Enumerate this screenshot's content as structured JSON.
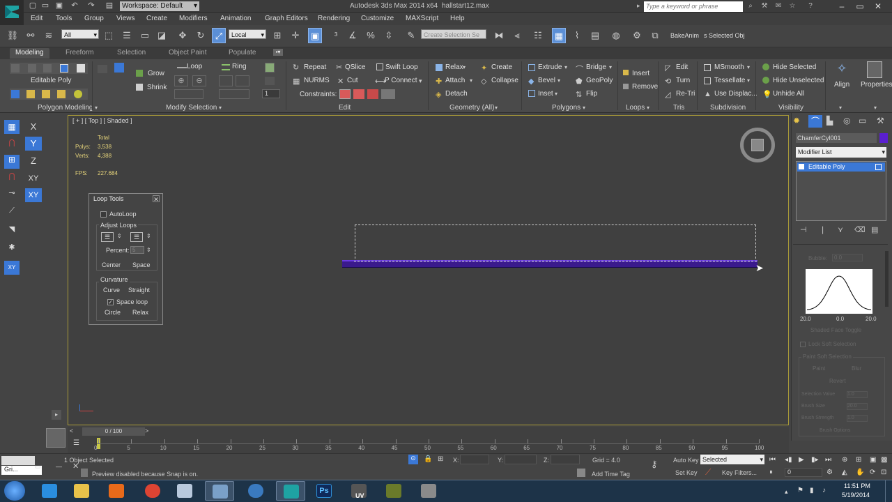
{
  "titlebar": {
    "workspace": "Workspace: Default",
    "app_title": "Autodesk 3ds Max  2014 x64",
    "file_title": "hallstart12.max",
    "search_placeholder": "Type a keyword or phrase"
  },
  "menu": [
    "Edit",
    "Tools",
    "Group",
    "Views",
    "Create",
    "Modifiers",
    "Animation",
    "Graph Editors",
    "Rendering",
    "Customize",
    "MAXScript",
    "Help"
  ],
  "toolbar": {
    "selection_filter": "All",
    "ref_coord": "Local",
    "named_selection": "Create Selection Se",
    "bake_anim": "BakeAnim",
    "selected_obj": "s Selected Obj"
  },
  "ribbon_tabs": [
    "Modeling",
    "Freeform",
    "Selection",
    "Object Paint",
    "Populate"
  ],
  "ribbon": {
    "poly_modeling": {
      "editable_poly": "Editable Poly",
      "title": "Polygon Modeling"
    },
    "modify_selection": {
      "grow": "Grow",
      "shrink": "Shrink",
      "loop": "Loop",
      "ring": "Ring",
      "title": "Modify Selection",
      "spinner": "1"
    },
    "edit": {
      "repeat": "Repeat",
      "qslice": "QSlice",
      "swift_loop": "Swift Loop",
      "nurms": "NURMS",
      "cut": "Cut",
      "p_connect": "P Connect",
      "constraints": "Constraints:",
      "title": "Edit"
    },
    "geometry": {
      "relax": "Relax",
      "create": "Create",
      "attach": "Attach",
      "collapse": "Collapse",
      "detach": "Detach",
      "title": "Geometry (All)"
    },
    "polygons": {
      "extrude": "Extrude",
      "bridge": "Bridge",
      "bevel": "Bevel",
      "geopoly": "GeoPoly",
      "inset": "Inset",
      "flip": "Flip",
      "title": "Polygons"
    },
    "loops": {
      "insert": "Insert",
      "remove": "Remove",
      "title": "Loops"
    },
    "tris": {
      "edit": "Edit",
      "turn": "Turn",
      "retri": "Re-Tri",
      "title": "Tris"
    },
    "subdivision": {
      "msmooth": "MSmooth",
      "tessellate": "Tessellate",
      "use_displac": "Use Displac...",
      "title": "Subdivision"
    },
    "visibility": {
      "hide_selected": "Hide Selected",
      "hide_unselected": "Hide Unselected",
      "unhide_all": "Unhide All",
      "title": "Visibility"
    },
    "align": "Align",
    "properties": "Properties"
  },
  "axis_buttons": [
    "X",
    "Y",
    "Z",
    "XY",
    "XY"
  ],
  "viewport": {
    "label": "[ + ] [ Top ] [ Shaded ]",
    "stats": {
      "total": "Total",
      "polys_label": "Polys:",
      "polys": "3,538",
      "verts_label": "Verts:",
      "verts": "4,388",
      "fps_label": "FPS:",
      "fps": "227.684"
    }
  },
  "loop_tools": {
    "title": "Loop Tools",
    "autoloop": "AutoLoop",
    "adjust_loops": "Adjust Loops",
    "percent_label": "Percent:",
    "percent_value": "5",
    "center": "Center",
    "space": "Space",
    "curvature": "Curvature",
    "curve": "Curve",
    "straight": "Straight",
    "space_loop": "Space loop",
    "circle": "Circle",
    "relax": "Relax"
  },
  "command_panel": {
    "object_name": "ChamferCyl001",
    "modifier_list": "Modifier List",
    "stack_item": "Editable Poly",
    "bubble_label": "Bubble:",
    "bubble_value": "0.0",
    "curve_labels": [
      "20.0",
      "0.0",
      "20.0"
    ],
    "shaded_face_toggle": "Shaded Face Toggle",
    "lock_soft_selection": "Lock Soft Selection",
    "paint_soft_selection": "Paint Soft Selection",
    "paint": "Paint",
    "blur": "Blur",
    "revert": "Revert",
    "selection_value_label": "Selection Value",
    "selection_value": "1.0",
    "brush_size_label": "Brush Size",
    "brush_size": "20.0",
    "brush_strength_label": "Brush Strength",
    "brush_strength": "1.0",
    "brush_options": "Brush Options"
  },
  "timeline": {
    "frame": "0 / 100",
    "ticks": [
      "0",
      "5",
      "10",
      "15",
      "20",
      "25",
      "30",
      "35",
      "40",
      "45",
      "50",
      "55",
      "60",
      "65",
      "70",
      "75",
      "80",
      "85",
      "90",
      "95",
      "100"
    ]
  },
  "statusbar": {
    "mini_listener": "Gri...",
    "selected_count": "1 Object Selected",
    "prompt": "Preview disabled because Snap is on.",
    "x_label": "X:",
    "y_label": "Y:",
    "z_label": "Z:",
    "grid": "Grid = 4.0",
    "add_time_tag": "Add Time Tag",
    "auto_key": "Auto Key",
    "set_key": "Set Key",
    "key_mode": "Selected",
    "key_filters": "Key Filters...",
    "frame_field": "0"
  },
  "taskbar": {
    "time": "11:51 PM",
    "date": "5/19/2014",
    "uv_label": "UV"
  },
  "colors": {
    "selection_purple": "#3a1a8c",
    "active_blue": "#3b78d6",
    "viewport_border": "#a89a38",
    "stats_yellow": "#e6d47a"
  }
}
